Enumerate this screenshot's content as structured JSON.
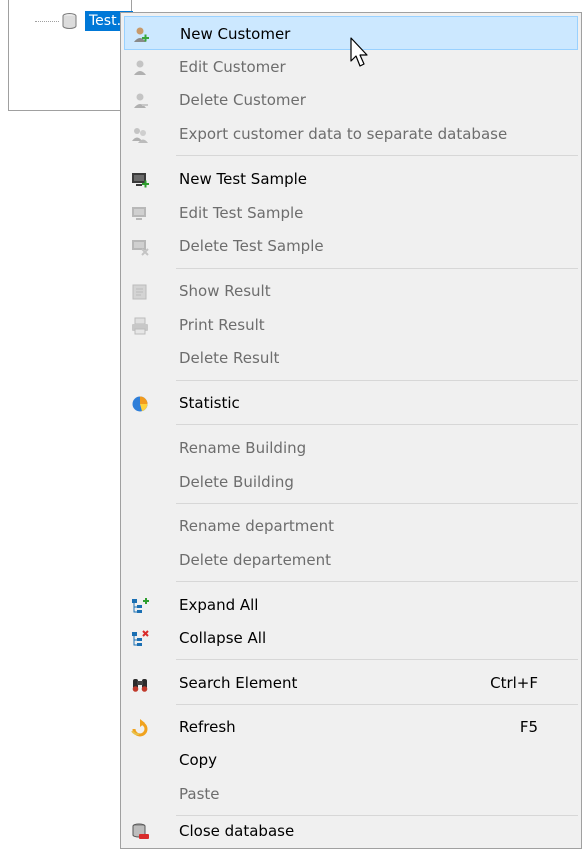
{
  "tree": {
    "node_label": "Test.db"
  },
  "context_menu": {
    "items": [
      {
        "label": "New Customer",
        "icon": "new-customer-icon",
        "enabled": true,
        "highlighted": true
      },
      {
        "label": "Edit Customer",
        "icon": "edit-customer-icon",
        "enabled": false
      },
      {
        "label": "Delete Customer",
        "icon": "delete-customer-icon",
        "enabled": false
      },
      {
        "label": "Export customer data to separate database",
        "icon": "export-customer-icon",
        "enabled": false
      },
      {
        "label": "New Test Sample",
        "icon": "new-test-sample-icon",
        "enabled": true
      },
      {
        "label": "Edit Test Sample",
        "icon": "edit-test-sample-icon",
        "enabled": false
      },
      {
        "label": "Delete Test Sample",
        "icon": "delete-test-sample-icon",
        "enabled": false
      },
      {
        "label": "Show Result",
        "icon": "show-result-icon",
        "enabled": false
      },
      {
        "label": "Print Result",
        "icon": "printer-icon",
        "enabled": false
      },
      {
        "label": "Delete Result",
        "icon": "",
        "enabled": false
      },
      {
        "label": "Statistic",
        "icon": "pie-chart-icon",
        "enabled": true
      },
      {
        "label": "Rename Building",
        "icon": "",
        "enabled": false
      },
      {
        "label": "Delete Building",
        "icon": "",
        "enabled": false
      },
      {
        "label": "Rename department",
        "icon": "",
        "enabled": false
      },
      {
        "label": "Delete departement",
        "icon": "",
        "enabled": false
      },
      {
        "label": "Expand All",
        "icon": "expand-tree-icon",
        "enabled": true
      },
      {
        "label": "Collapse All",
        "icon": "collapse-tree-icon",
        "enabled": true
      },
      {
        "label": "Search Element",
        "icon": "binoculars-icon",
        "enabled": true,
        "shortcut": "Ctrl+F"
      },
      {
        "label": "Refresh",
        "icon": "refresh-icon",
        "enabled": true,
        "shortcut": "F5"
      },
      {
        "label": "Copy",
        "icon": "",
        "enabled": true
      },
      {
        "label": "Paste",
        "icon": "",
        "enabled": false
      },
      {
        "label": "Close database",
        "icon": "close-database-icon",
        "enabled": true
      }
    ]
  },
  "colors": {
    "highlight_bg": "#cce8ff",
    "highlight_border": "#99d1ff",
    "selection_blue": "#0078d7",
    "menu_bg": "#f0f0f0",
    "disabled_text": "#6d6d6d"
  }
}
